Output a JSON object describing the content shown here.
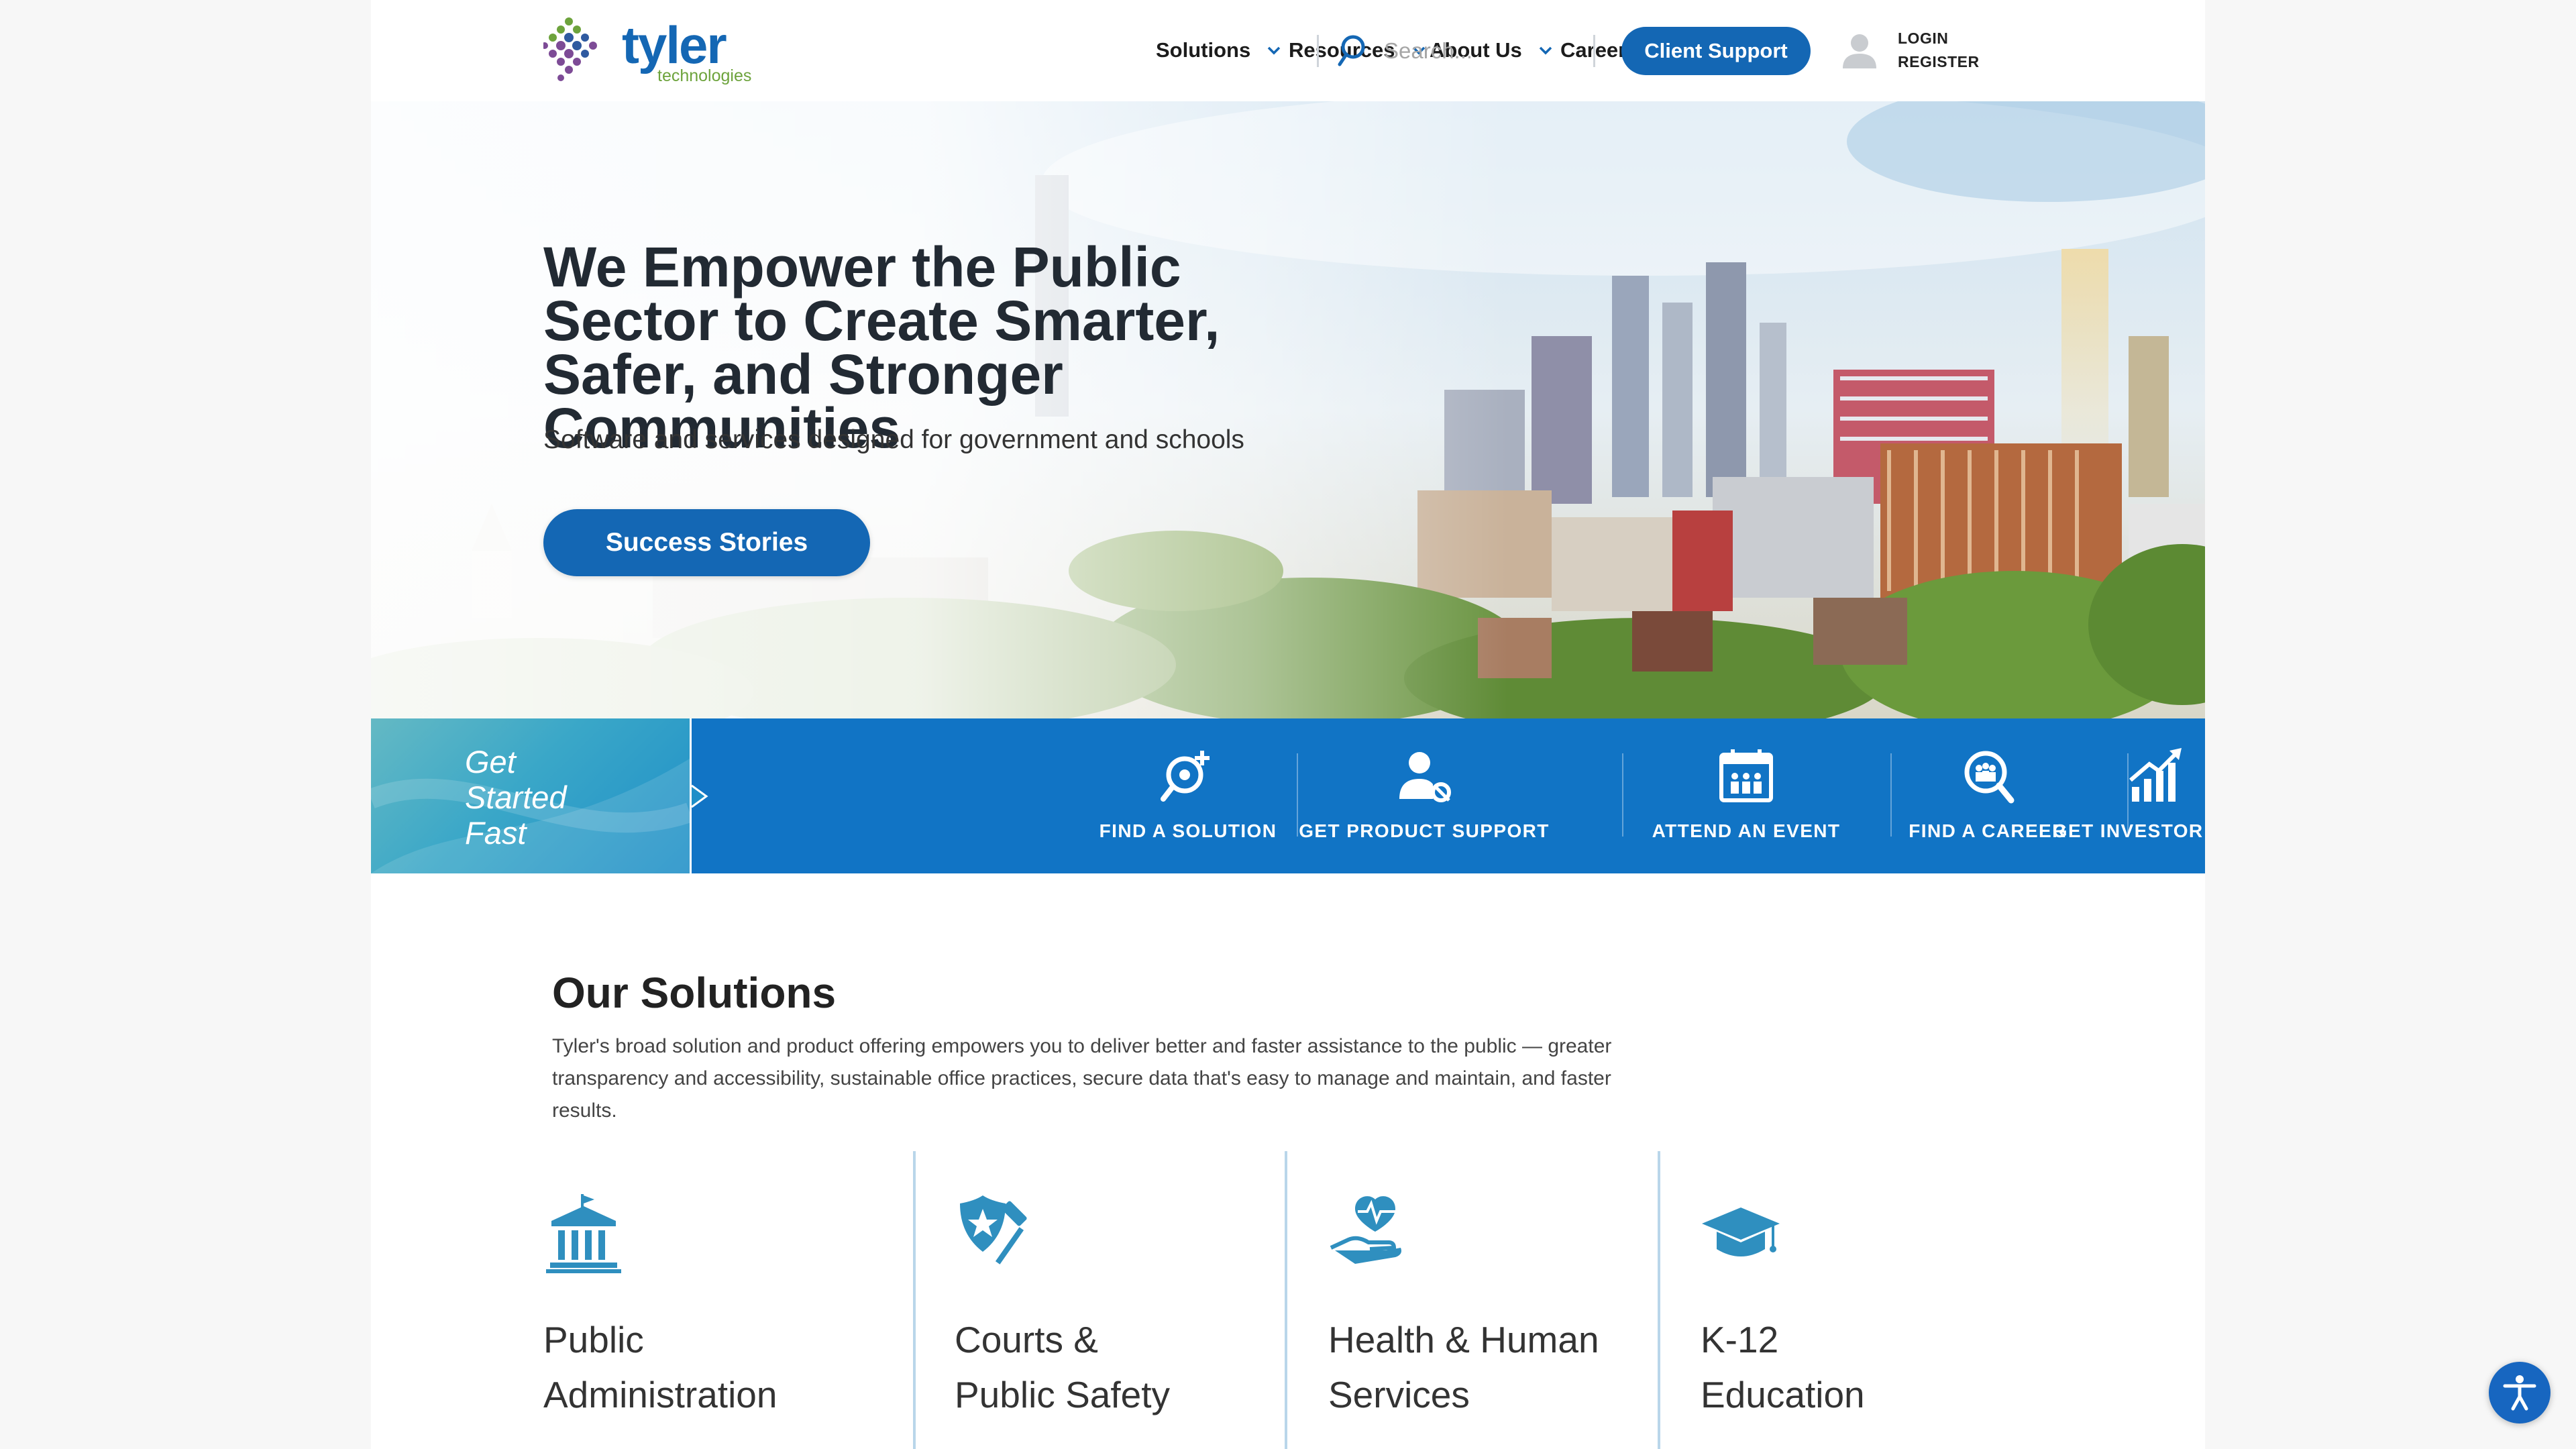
{
  "header": {
    "logo_text": "tyler",
    "logo_subtext": "technologies",
    "nav": [
      {
        "label": "Solutions",
        "icon": "chevron-down-icon"
      },
      {
        "label": "Resources",
        "icon": "chevron-down-icon"
      },
      {
        "label": "About Us",
        "icon": "chevron-down-icon"
      },
      {
        "label": "Careers",
        "icon": "chevron-down-icon"
      }
    ],
    "search_placeholder": "Search...",
    "support_button": "Client Support",
    "login": "LOGIN",
    "register": "REGISTER"
  },
  "hero": {
    "title": "We Empower the Public Sector to Create Smarter, Safer, and Stronger Communities",
    "subtitle": "Software and services designed for government and schools",
    "button": "Success Stories"
  },
  "get_started": {
    "label": "Get Started Fast",
    "items": [
      {
        "label": "FIND A SOLUTION",
        "icon": "solution-search-icon"
      },
      {
        "label": "GET PRODUCT SUPPORT",
        "icon": "product-support-icon"
      },
      {
        "label": "ATTEND AN EVENT",
        "icon": "calendar-event-icon"
      },
      {
        "label": "FIND A CAREER",
        "icon": "career-search-icon"
      },
      {
        "label": "GET INVESTOR INFO",
        "icon": "growth-chart-icon"
      }
    ]
  },
  "solutions": {
    "title_light": "Our",
    "title_bold": "Solutions",
    "description": "Tyler's broad solution and product offering empowers you to deliver better and faster assistance to the public — greater transparency and accessibility, sustainable office practices, secure data that's easy to manage and maintain, and faster results.",
    "categories": [
      {
        "line1": "Public",
        "line2": "Administration",
        "icon": "government-building-icon"
      },
      {
        "line1": "Courts &",
        "line2": "Public Safety",
        "icon": "badge-gavel-icon"
      },
      {
        "line1": "Health & Human",
        "line2": "Services",
        "icon": "heart-hand-icon"
      },
      {
        "line1": "K-12",
        "line2": "Education",
        "icon": "graduation-cap-icon"
      }
    ]
  },
  "accessibility_button": "accessibility-icon",
  "colors": {
    "brand_blue": "#1467b4",
    "band_blue": "#1174c5",
    "icon_teal": "#2f8fbf",
    "logo_green": "#6da33c"
  }
}
